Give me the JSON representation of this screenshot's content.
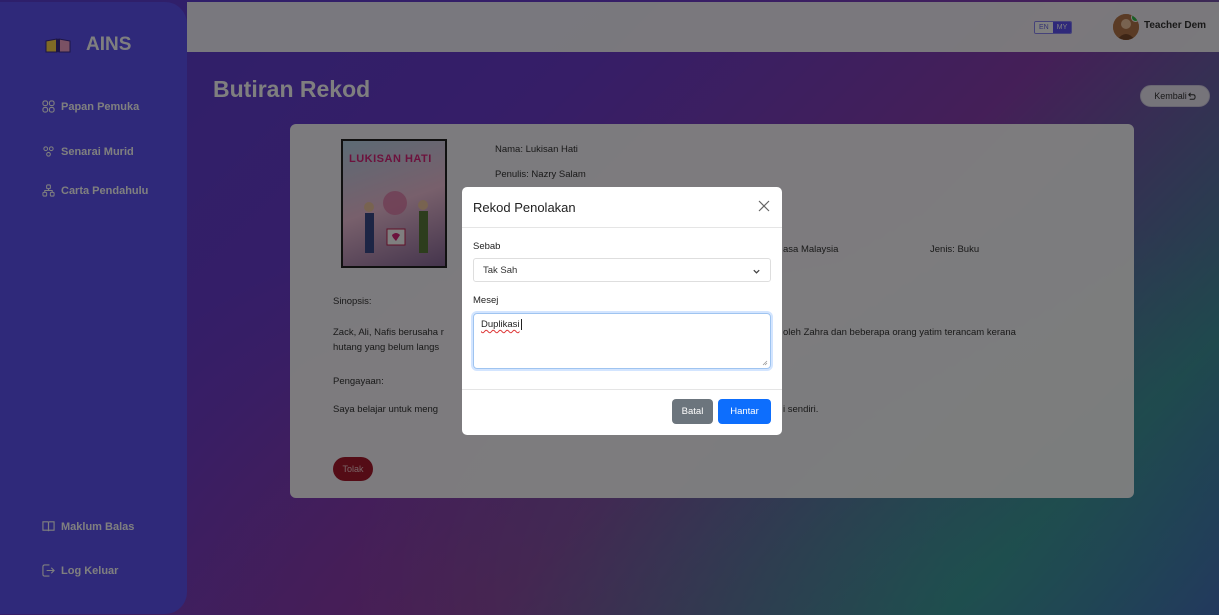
{
  "app": {
    "brand": "AINS"
  },
  "sidebar": {
    "items": [
      {
        "label": "Papan Pemuka",
        "icon": "grid-icon"
      },
      {
        "label": "Senarai Murid",
        "icon": "users-icon"
      },
      {
        "label": "Carta Pendahulu",
        "icon": "hierarchy-icon"
      }
    ],
    "bottom_items": [
      {
        "label": "Maklum Balas",
        "icon": "book-icon"
      },
      {
        "label": "Log Keluar",
        "icon": "logout-icon"
      }
    ]
  },
  "topbar": {
    "lang_en": "EN",
    "lang_my": "MY",
    "user_name": "Teacher Dem"
  },
  "page": {
    "title": "Butiran Rekod",
    "back_label": "Kembali"
  },
  "record": {
    "cover_title": "LUKISAN HATI",
    "name_line": "Nama: Lukisan Hati",
    "author_line": "Penulis: Nazry Salam",
    "language_fragment": "asa Malaysia",
    "type_line": "Jenis: Buku",
    "synopsis_label": "Sinopsis:",
    "synopsis_left": "Zack, Ali, Nafis berusaha r",
    "synopsis_left_2": "hutang yang belum langs",
    "synopsis_right": "oleh Zahra dan beberapa orang yatim terancam kerana",
    "enrichment_label": "Pengayaan:",
    "enrichment_left": "Saya belajar untuk meng",
    "enrichment_right": "i sendiri.",
    "reject_label": "Tolak"
  },
  "modal": {
    "title": "Rekod Penolakan",
    "reason_label": "Sebab",
    "reason_value": "Tak Sah",
    "message_label": "Mesej",
    "message_value": "Duplikasi",
    "cancel_label": "Batal",
    "submit_label": "Hantar"
  },
  "colors": {
    "sidebar": "#5e52f4",
    "primary": "#0d6efd",
    "danger": "#a8182c",
    "secondary": "#6c757d"
  }
}
